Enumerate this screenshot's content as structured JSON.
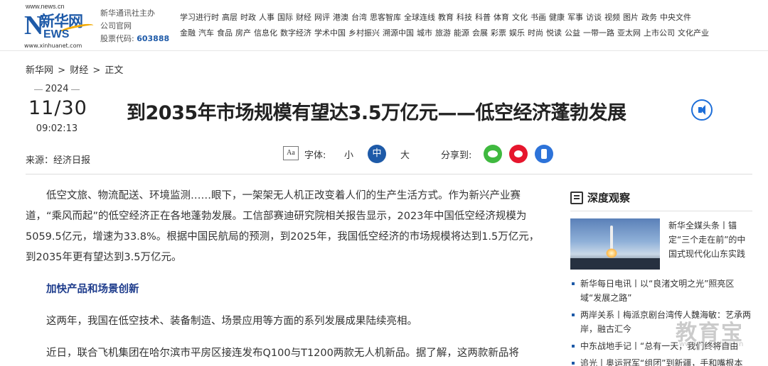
{
  "header": {
    "logo": {
      "domain": "www.news.cn",
      "cn": "新华网",
      "n": "N",
      "ews": "EWS",
      "site": "www.xinhuanet.com"
    },
    "org_line1": "新华通讯社主办",
    "org_line2": "公司官网",
    "stock_label": "股票代码:",
    "stock_code": "603888",
    "nav_row1": [
      "学习进行时",
      "高层",
      "时政",
      "人事",
      "国际",
      "财经",
      "网评",
      "港澳",
      "台湾",
      "思客智库",
      "全球连线",
      "教育",
      "科技",
      "科普",
      "体育",
      "文化",
      "书画",
      "健康",
      "军事",
      "访谈",
      "视频",
      "图片",
      "政务",
      "中央文件"
    ],
    "nav_row2": [
      "金融",
      "汽车",
      "食品",
      "房产",
      "信息化",
      "数字经济",
      "学术中国",
      "乡村振兴",
      "溯源中国",
      "城市",
      "旅游",
      "能源",
      "会展",
      "彩票",
      "娱乐",
      "时尚",
      "悦读",
      "公益",
      "一带一路",
      "亚太网",
      "上市公司",
      "文化产业"
    ]
  },
  "breadcrumb": [
    "新华网",
    ">",
    "财经",
    ">",
    "正文"
  ],
  "date": {
    "year": "2024",
    "day": "11/30",
    "time": "09:02:13"
  },
  "source": "来源：经济日报",
  "title": "到2035年市场规模有望达3.5万亿元——低空经济蓬勃发展",
  "toolbar": {
    "aa": "Aa",
    "font_label": "字体:",
    "small": "小",
    "medium": "中",
    "large": "大",
    "share_label": "分享到:"
  },
  "article": {
    "p1": "低空文旅、物流配送、环境监测……眼下，一架架无人机正改变着人们的生产生活方式。作为新兴产业赛道，“乘风而起”的低空经济正在各地蓬勃发展。工信部赛迪研究院相关报告显示，2023年中国低空经济规模为5059.5亿元，增速为33.8%。根据中国民航局的预测，到2025年，我国低空经济的市场规模将达到1.5万亿元，到2035年更有望达到3.5万亿元。",
    "h1": "加快产品和场景创新",
    "p2": "这两年，我国在低空技术、装备制造、场景应用等方面的系列发展成果陆续亮相。",
    "p3": "近日，联合飞机集团在哈尔滨市平房区接连发布Q100与T1200两款无人机新品。据了解，这两款新品将"
  },
  "sidebar": {
    "heading": "深度观察",
    "feature_text": "新华全媒头条丨锚定“三个走在前”的中国式现代化山东实践",
    "items": [
      "新华每日电讯丨以“良渚文明之光”照亮区域“发展之路”",
      "两岸关系丨梅派京剧台湾传人魏海敏：艺承两岸，融古汇今",
      "中东战地手记丨“总有一天，我们终将自由",
      "追光丨奥运冠军“组团”到新疆，手和嘴根本"
    ]
  },
  "watermark": {
    "main": "教育宝",
    "sub": "www.jiaoyubao.cn"
  }
}
